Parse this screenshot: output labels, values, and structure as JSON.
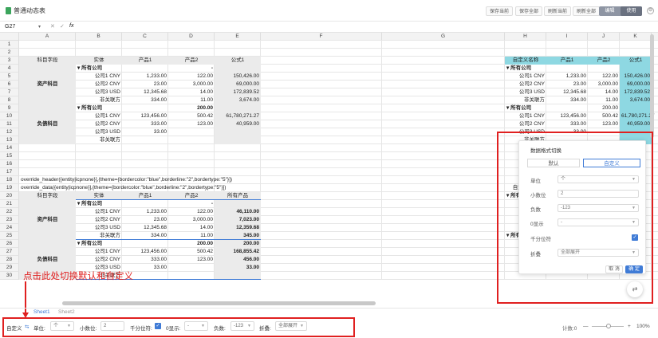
{
  "window": {
    "title": "普通动态表"
  },
  "toolbar": {
    "buttons": [
      "保存当前",
      "保存全部",
      "刷新当前",
      "刷新全部"
    ],
    "toggle": {
      "left": "编辑",
      "right": "使用"
    },
    "minimize": "⊖"
  },
  "formula_bar": {
    "cell": "G27",
    "arrow": "▾",
    "cancel": "✕",
    "confirm": "✓",
    "fx": "fx",
    "value": ""
  },
  "columns": [
    "A",
    "B",
    "C",
    "D",
    "E",
    "F",
    "G",
    "H",
    "I",
    "J",
    "K",
    "L"
  ],
  "rows": [
    "1",
    "2",
    "3",
    "4",
    "5",
    "6",
    "7",
    "8",
    "9",
    "10",
    "11",
    "12",
    "13",
    "14",
    "15",
    "16",
    "17",
    "18",
    "19",
    "20",
    "21",
    "22",
    "23",
    "24",
    "25",
    "26",
    "27",
    "28",
    "29",
    "30"
  ],
  "left_table1": {
    "header": [
      "科目字段",
      "实体",
      "产品1",
      "产品2",
      "公式1"
    ],
    "sections": [
      {
        "label": "资产科目",
        "rows": [
          [
            "▾ 所有公司",
            "",
            "-",
            ""
          ],
          [
            "公司1 CNY",
            "1,233.00",
            "122.00",
            "150,426.00"
          ],
          [
            "公司2 CNY",
            "23.00",
            "3,000.00",
            "69,000.00"
          ],
          [
            "公司3 USD",
            "12,345.68",
            "14.00",
            "172,839.52"
          ],
          [
            "非关联方",
            "334.00",
            "11.00",
            "3,674.00"
          ]
        ]
      },
      {
        "label": "负债科目",
        "rows": [
          [
            "▾ 所有公司",
            "",
            "200.00",
            ""
          ],
          [
            "公司1 CNY",
            "123,456.00",
            "500.42",
            "61,780,271.27"
          ],
          [
            "公司2 CNY",
            "333.00",
            "123.00",
            "40,959.00"
          ],
          [
            "公司3 USD",
            "33.00",
            "",
            ""
          ],
          [
            "非关联方",
            "",
            "",
            ""
          ]
        ]
      }
    ]
  },
  "override_lines": [
    "override_header({entity|icpnone}],{theme={bordercolor:\"blue\",borderline:\"2\",bordertype:\"5\"}])",
    "override_data({entity|icpnone}],{theme={bordercolor:\"blue\",borderline:\"2\",bordertype:\"5\"}])"
  ],
  "left_table2": {
    "header": [
      "科目字段",
      "实体",
      "产品1",
      "产品2",
      "所有产品"
    ],
    "sections": [
      {
        "label": "资产科目",
        "rows": [
          [
            "▾ 所有公司",
            "",
            "-",
            ""
          ],
          [
            "公司1 CNY",
            "1,233.00",
            "122.00",
            "46,110.00"
          ],
          [
            "公司2 CNY",
            "23.00",
            "3,000.00",
            "7,023.00"
          ],
          [
            "公司3 USD",
            "12,345.68",
            "14.00",
            "12,359.68"
          ],
          [
            "非关联方",
            "334.00",
            "11.00",
            "345.00"
          ]
        ]
      },
      {
        "label": "负债科目",
        "rows": [
          [
            "▾ 所有公司",
            "",
            "200.00",
            "200.00"
          ],
          [
            "公司1 CNY",
            "123,456.00",
            "500.42",
            "168,855.42"
          ],
          [
            "公司2 CNY",
            "333.00",
            "123.00",
            "456.00"
          ],
          [
            "公司3 USD",
            "33.00",
            "",
            "33.00"
          ],
          [
            "非关联方",
            "",
            "",
            ""
          ]
        ]
      }
    ]
  },
  "right_table1": {
    "header": [
      "自定义名称",
      "产品1",
      "产品2",
      "公式1"
    ],
    "rows": [
      [
        "▾ 所有公司",
        "",
        "",
        ""
      ],
      [
        "公司1 CNY",
        "1,233.00",
        "122.00",
        "150,426.00"
      ],
      [
        "公司2 CNY",
        "23.00",
        "3,000.00",
        "69,000.00"
      ],
      [
        "公司3 USD",
        "12,345.68",
        "14.00",
        "172,839.52"
      ],
      [
        "非关联方",
        "334.00",
        "11.00",
        "3,674.00"
      ],
      [
        "▾ 所有公司",
        "",
        "200.00",
        ""
      ],
      [
        "公司1 CNY",
        "123,456.00",
        "500.42",
        "61,780,271.27"
      ],
      [
        "公司2 CNY",
        "333.00",
        "123.00",
        "40,959.00"
      ],
      [
        "公司3 USD",
        "33.00",
        "",
        ""
      ],
      [
        "非关联方",
        "",
        "",
        ""
      ]
    ]
  },
  "right_table2": {
    "header": "自定义名称",
    "rows": [
      "▾ 所有公司",
      "公司1 CNY",
      "公司2 CNY",
      "公司3 USD",
      "非关联方",
      "▾ 所有公司",
      "公司1 CNY",
      "公司2 CNY",
      "公司3 USD",
      "非关联方"
    ]
  },
  "panel": {
    "title": "数据格式切换",
    "tabs": [
      "默认",
      "自定义"
    ],
    "fields": [
      {
        "label": "单位",
        "value": "个"
      },
      {
        "label": "小数位",
        "value": "2"
      },
      {
        "label": "负数",
        "value": "-123"
      },
      {
        "label": "0显示",
        "value": "-"
      },
      {
        "label": "千分位符",
        "value": ""
      },
      {
        "label": "折叠",
        "value": "全部展开"
      }
    ],
    "cancel": "取 消",
    "ok": "确 定",
    "swap_icon": "⇄"
  },
  "annotation": "点击此处切换默认和自定义",
  "sheets": [
    "Sheet1",
    "Sheet2"
  ],
  "bottom": {
    "custom_label": "自定义",
    "unit_label": "单位:",
    "unit_value": "个",
    "decimals_label": "小数位:",
    "decimals_value": "2",
    "thousands_label": "千分位符:",
    "zero_label": "0显示:",
    "zero_value": "-",
    "negative_label": "负数:",
    "negative_value": "-123",
    "fold_label": "折叠:",
    "fold_value": "全部展开",
    "count": "计数:0",
    "zoom": "100%"
  },
  "colors": {
    "accent": "#3f7bd6",
    "highlight": "#8ed8e2",
    "annotation": "#e02020"
  }
}
